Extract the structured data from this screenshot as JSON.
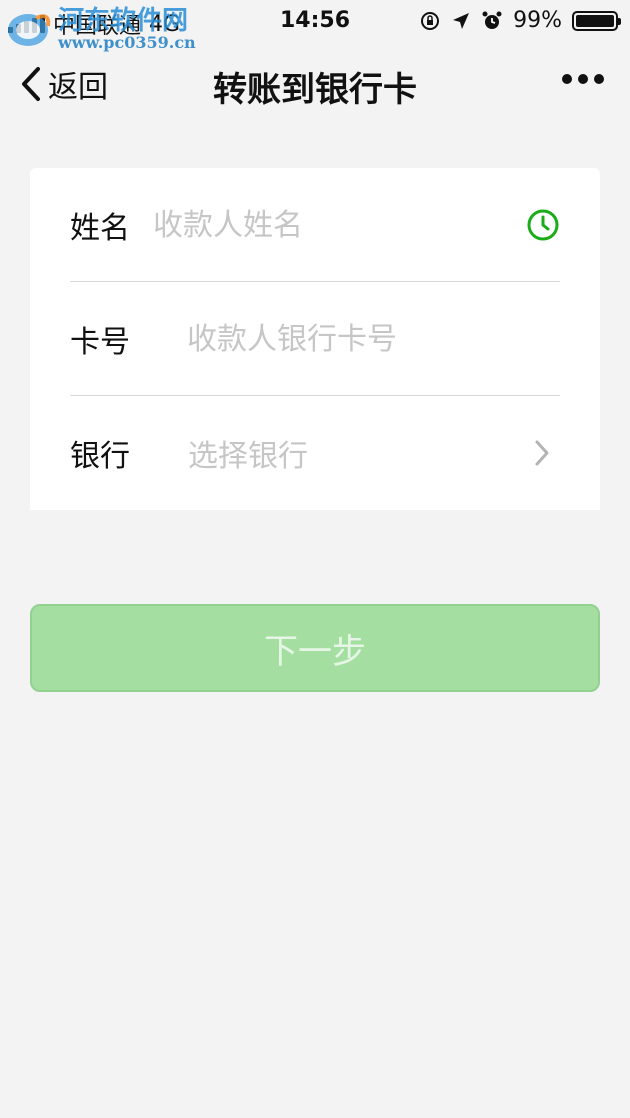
{
  "status_bar": {
    "carrier": "中国联通",
    "network": "4G",
    "time": "14:56",
    "battery": "99%",
    "battery_level": 0.99
  },
  "watermark": {
    "name": "河东软件网",
    "url": "www.pc0359.cn"
  },
  "nav": {
    "back_label": "返回",
    "title": "转账到银行卡"
  },
  "form": {
    "name": {
      "label": "姓名",
      "placeholder": "收款人姓名"
    },
    "card": {
      "label": "卡号",
      "placeholder": "收款人银行卡号"
    },
    "bank": {
      "label": "银行",
      "placeholder": "选择银行"
    }
  },
  "next_button": {
    "label": "下一步"
  },
  "colors": {
    "background": "#f3f3f3",
    "accent_green": "#1aad19",
    "button_disabled": "#a4dfa1",
    "placeholder": "#c6c6c6"
  },
  "icons": [
    "signal-icon",
    "rotation-lock-icon",
    "location-icon",
    "alarm-icon",
    "battery-icon",
    "chevron-left-icon",
    "more-icon",
    "clock-icon",
    "chevron-right-icon"
  ]
}
